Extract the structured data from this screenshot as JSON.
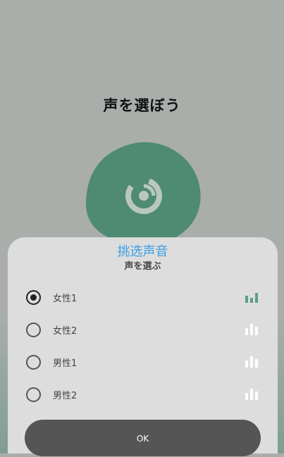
{
  "page": {
    "title": "声を選ぼう"
  },
  "sheet": {
    "title": "挑选声音",
    "subtitle": "声を選ぶ",
    "options": [
      {
        "label": "女性1",
        "selected": true,
        "icon": "sound-bars-icon",
        "icon_color": "#5a9e88"
      },
      {
        "label": "女性2",
        "selected": false,
        "icon": "sound-bars-icon",
        "icon_color": "#ffffff"
      },
      {
        "label": "男性1",
        "selected": false,
        "icon": "sound-bars-icon",
        "icon_color": "#ffffff"
      },
      {
        "label": "男性2",
        "selected": false,
        "icon": "sound-bars-icon",
        "icon_color": "#ffffff"
      }
    ],
    "ok_label": "OK"
  },
  "colors": {
    "accent_green": "#4f8a73",
    "title_blue": "#3a9ee8",
    "button_dark": "#555555"
  }
}
